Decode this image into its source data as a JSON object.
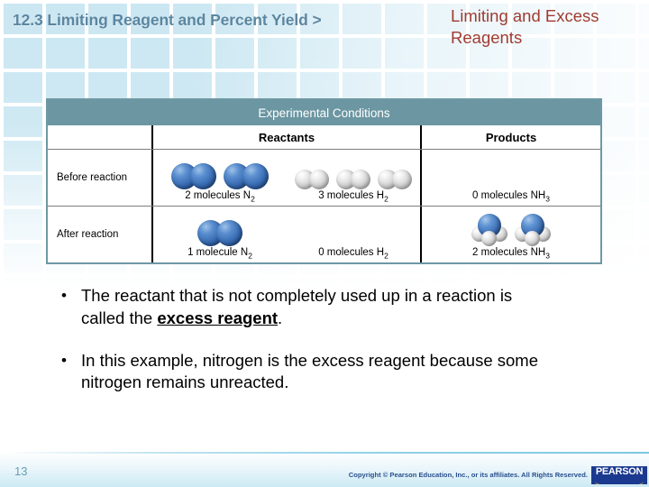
{
  "header": {
    "breadcrumb": "12.3 Limiting Reagent and Percent Yield >",
    "title": "Limiting and Excess Reagents",
    "breadcrumb_color": "#5b86a0",
    "title_color": "#a03b32"
  },
  "table": {
    "banner": "Experimental Conditions",
    "column_headers": {
      "corner": "",
      "reactants": "Reactants",
      "products": "Products"
    },
    "banner_color": "#6b96a2",
    "rows": [
      {
        "label": "Before reaction",
        "reactants": [
          {
            "caption_count": "2 molecules",
            "formula": "N",
            "subscript": "2",
            "molecule": "n2-molecule",
            "repeat": 2
          },
          {
            "caption_count": "3 molecules",
            "formula": "H",
            "subscript": "2",
            "molecule": "h2-molecule",
            "repeat": 3
          }
        ],
        "products": [
          {
            "caption_count": "0 molecules",
            "formula": "NH",
            "subscript": "3",
            "molecule": "nh3-molecule",
            "repeat": 0
          }
        ]
      },
      {
        "label": "After reaction",
        "reactants": [
          {
            "caption_count": "1 molecule",
            "formula": "N",
            "subscript": "2",
            "molecule": "n2-molecule",
            "repeat": 1
          },
          {
            "caption_count": "0 molecules",
            "formula": "H",
            "subscript": "2",
            "molecule": "h2-molecule",
            "repeat": 0
          }
        ],
        "products": [
          {
            "caption_count": "2 molecules",
            "formula": "NH",
            "subscript": "3",
            "molecule": "nh3-molecule",
            "repeat": 2
          }
        ]
      }
    ]
  },
  "bullets": [
    {
      "marker": "•",
      "pre": "The reactant that is not completely used up in a reaction is called the ",
      "emphasis": "excess reagent",
      "post": "."
    },
    {
      "marker": "•",
      "pre": "In this example, nitrogen is the excess reagent because some nitrogen remains unreacted.",
      "emphasis": "",
      "post": ""
    }
  ],
  "footer": {
    "page_number": "13",
    "copyright": "Copyright © Pearson Education, Inc., or its affiliates. All Rights Reserved.",
    "logo_text": "PEARSON",
    "logo_bg": "#1b3a8f",
    "logo_arc_color": "#f2b824"
  }
}
